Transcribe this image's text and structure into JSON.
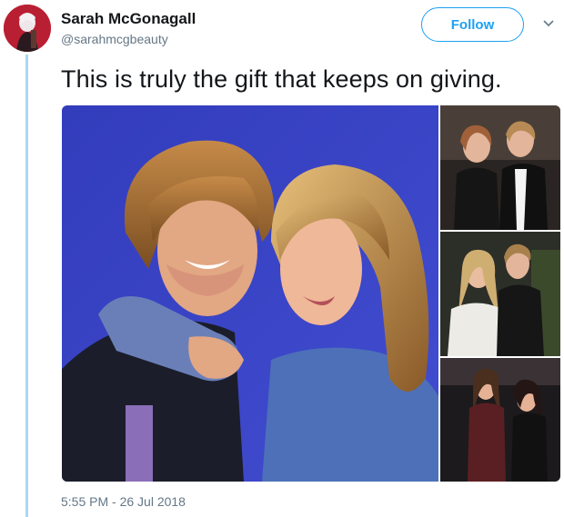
{
  "author": {
    "display_name": "Sarah McGonagall",
    "handle": "@sarahmcgbeauty"
  },
  "follow_button": {
    "label": "Follow"
  },
  "tweet": {
    "text": "This is truly the gift that keeps on giving.",
    "timestamp": "5:55 PM - 26 Jul 2018"
  },
  "media": {
    "photo_count": 4
  },
  "colors": {
    "accent": "#1da1f2",
    "thread_line": "#a9d8f6",
    "text_primary": "#14171a",
    "text_secondary": "#657786",
    "photo_main_background": "#3a44c8"
  },
  "icons": {
    "menu": "chevron-down-icon"
  }
}
